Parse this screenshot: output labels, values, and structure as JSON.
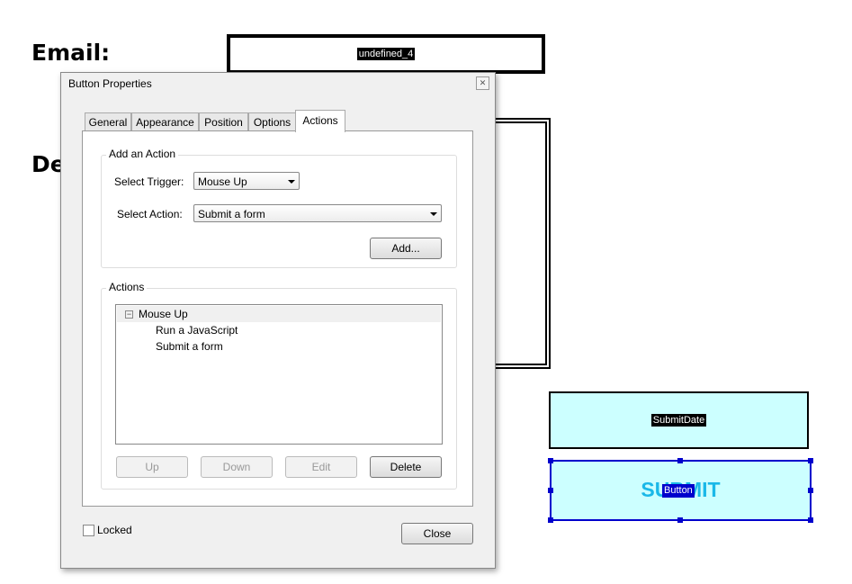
{
  "page": {
    "email_label": "Email:",
    "desc_label": "De",
    "email_field": "undefined_4",
    "submitdate_field": "SubmitDate",
    "submit_text": "SUBMIT",
    "button_tag": "Button"
  },
  "dialog": {
    "title": "Button Properties",
    "close_icon": "close-icon",
    "tabs": [
      {
        "label": "General"
      },
      {
        "label": "Appearance"
      },
      {
        "label": "Position"
      },
      {
        "label": "Options"
      },
      {
        "label": "Actions",
        "active": true
      }
    ],
    "add_group": {
      "title": "Add an Action",
      "trigger_label": "Select Trigger:",
      "trigger_value": "Mouse Up",
      "action_label": "Select Action:",
      "action_value": "Submit a form",
      "add_button": "Add..."
    },
    "actions_group": {
      "title": "Actions",
      "tree": {
        "node": "Mouse Up",
        "children": [
          "Run a JavaScript",
          "Submit a form"
        ]
      },
      "buttons": {
        "up": "Up",
        "down": "Down",
        "edit": "Edit",
        "delete": "Delete"
      }
    },
    "locked_label": "Locked",
    "locked_checked": false,
    "close_button": "Close"
  },
  "colors": {
    "field_bg": "#ccffff",
    "submit_text": "#1ab8e8",
    "selection": "#0000cc"
  }
}
